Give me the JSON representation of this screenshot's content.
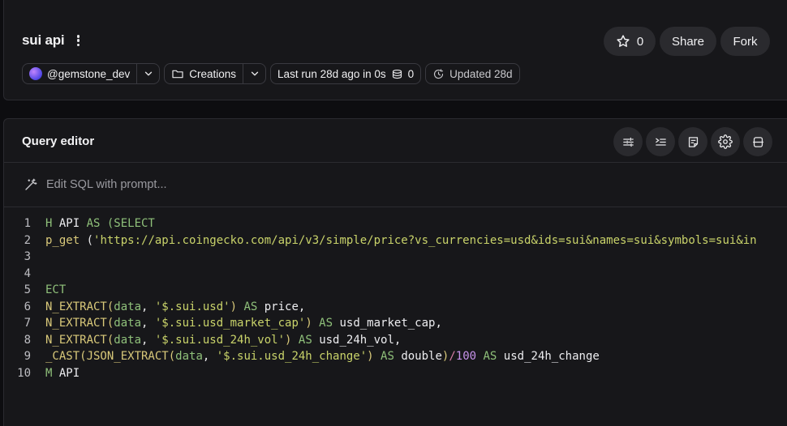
{
  "header": {
    "title": "sui api",
    "star_count": "0",
    "share_label": "Share",
    "fork_label": "Fork",
    "owner": "@gemstone_dev",
    "collection": "Creations",
    "last_run": "Last run 28d ago in 0s",
    "db_count": "0",
    "updated": "Updated 28d"
  },
  "editor": {
    "title": "Query editor",
    "prompt_placeholder": "Edit SQL with prompt...",
    "tools": [
      "sliders-icon",
      "format-icon",
      "notes-icon",
      "settings-icon",
      "layout-icon"
    ]
  },
  "code_lines": [
    {
      "n": "1",
      "tokens": [
        {
          "t": "H ",
          "c": "kw"
        },
        {
          "t": "API ",
          "c": "id"
        },
        {
          "t": "AS (SELECT",
          "c": "kw"
        }
      ]
    },
    {
      "n": "2",
      "tokens": [
        {
          "t": "p_get ",
          "c": "fn"
        },
        {
          "t": "(",
          "c": "op"
        },
        {
          "t": "'https://api.coingecko.com/api/v3/simple/price?vs_currencies=usd&ids=sui&names=sui&symbols=sui&in",
          "c": "str"
        }
      ]
    },
    {
      "n": "3",
      "tokens": []
    },
    {
      "n": "4",
      "tokens": []
    },
    {
      "n": "5",
      "tokens": [
        {
          "t": "ECT",
          "c": "kw"
        }
      ]
    },
    {
      "n": "6",
      "tokens": [
        {
          "t": "N_EXTRACT(",
          "c": "fn"
        },
        {
          "t": "data",
          "c": "kw"
        },
        {
          "t": ", ",
          "c": "op"
        },
        {
          "t": "'$.sui.usd'",
          "c": "str"
        },
        {
          "t": ") ",
          "c": "fn"
        },
        {
          "t": "AS ",
          "c": "kw"
        },
        {
          "t": "price,",
          "c": "id"
        }
      ]
    },
    {
      "n": "7",
      "tokens": [
        {
          "t": "N_EXTRACT(",
          "c": "fn"
        },
        {
          "t": "data",
          "c": "kw"
        },
        {
          "t": ", ",
          "c": "op"
        },
        {
          "t": "'$.sui.usd_market_cap'",
          "c": "str"
        },
        {
          "t": ") ",
          "c": "fn"
        },
        {
          "t": "AS ",
          "c": "kw"
        },
        {
          "t": "usd_market_cap,",
          "c": "id"
        }
      ]
    },
    {
      "n": "8",
      "tokens": [
        {
          "t": "N_EXTRACT(",
          "c": "fn"
        },
        {
          "t": "data",
          "c": "kw"
        },
        {
          "t": ", ",
          "c": "op"
        },
        {
          "t": "'$.sui.usd_24h_vol'",
          "c": "str"
        },
        {
          "t": ") ",
          "c": "fn"
        },
        {
          "t": "AS ",
          "c": "kw"
        },
        {
          "t": "usd_24h_vol,",
          "c": "id"
        }
      ]
    },
    {
      "n": "9",
      "tokens": [
        {
          "t": "_CAST(JSON_EXTRACT(",
          "c": "fn"
        },
        {
          "t": "data",
          "c": "kw"
        },
        {
          "t": ", ",
          "c": "op"
        },
        {
          "t": "'$.sui.usd_24h_change'",
          "c": "str"
        },
        {
          "t": ") ",
          "c": "fn"
        },
        {
          "t": "AS ",
          "c": "kw"
        },
        {
          "t": "double",
          "c": "id"
        },
        {
          "t": ")",
          "c": "fn"
        },
        {
          "t": "/",
          "c": "sl"
        },
        {
          "t": "100 ",
          "c": "num"
        },
        {
          "t": "AS ",
          "c": "kw"
        },
        {
          "t": "usd_24h_change",
          "c": "id"
        }
      ]
    },
    {
      "n": "10",
      "tokens": [
        {
          "t": "M ",
          "c": "kw"
        },
        {
          "t": "API",
          "c": "id"
        }
      ]
    }
  ]
}
